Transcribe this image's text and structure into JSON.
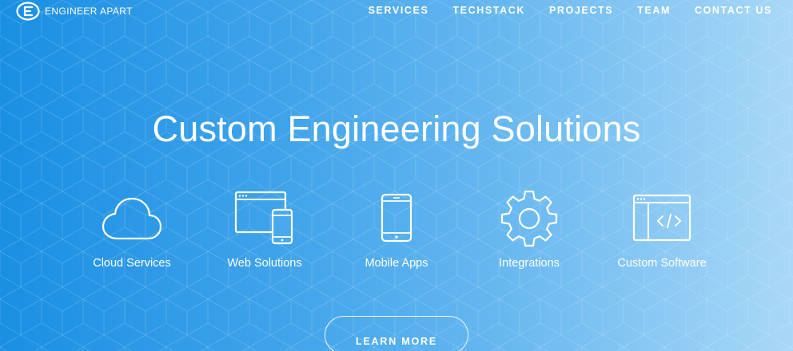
{
  "brand": {
    "name": "ENGINEER APART",
    "logo_icon": "e-circle-logo-icon"
  },
  "nav": {
    "items": [
      {
        "label": "SERVICES"
      },
      {
        "label": "TECHSTACK"
      },
      {
        "label": "PROJECTS"
      },
      {
        "label": "TEAM"
      },
      {
        "label": "CONTACT US"
      }
    ]
  },
  "hero": {
    "title": "Custom Engineering Solutions",
    "cta_label": "LEARN MORE"
  },
  "services": [
    {
      "label": "Cloud Services",
      "icon": "cloud-icon"
    },
    {
      "label": "Web Solutions",
      "icon": "browser-and-phone-icon"
    },
    {
      "label": "Mobile Apps",
      "icon": "smartphone-icon"
    },
    {
      "label": "Integrations",
      "icon": "gear-icon"
    },
    {
      "label": "Custom Software",
      "icon": "code-window-icon"
    }
  ],
  "colors": {
    "gradient_start": "#1a8fe3",
    "gradient_end": "#a9d8f7",
    "text": "#ffffff"
  }
}
